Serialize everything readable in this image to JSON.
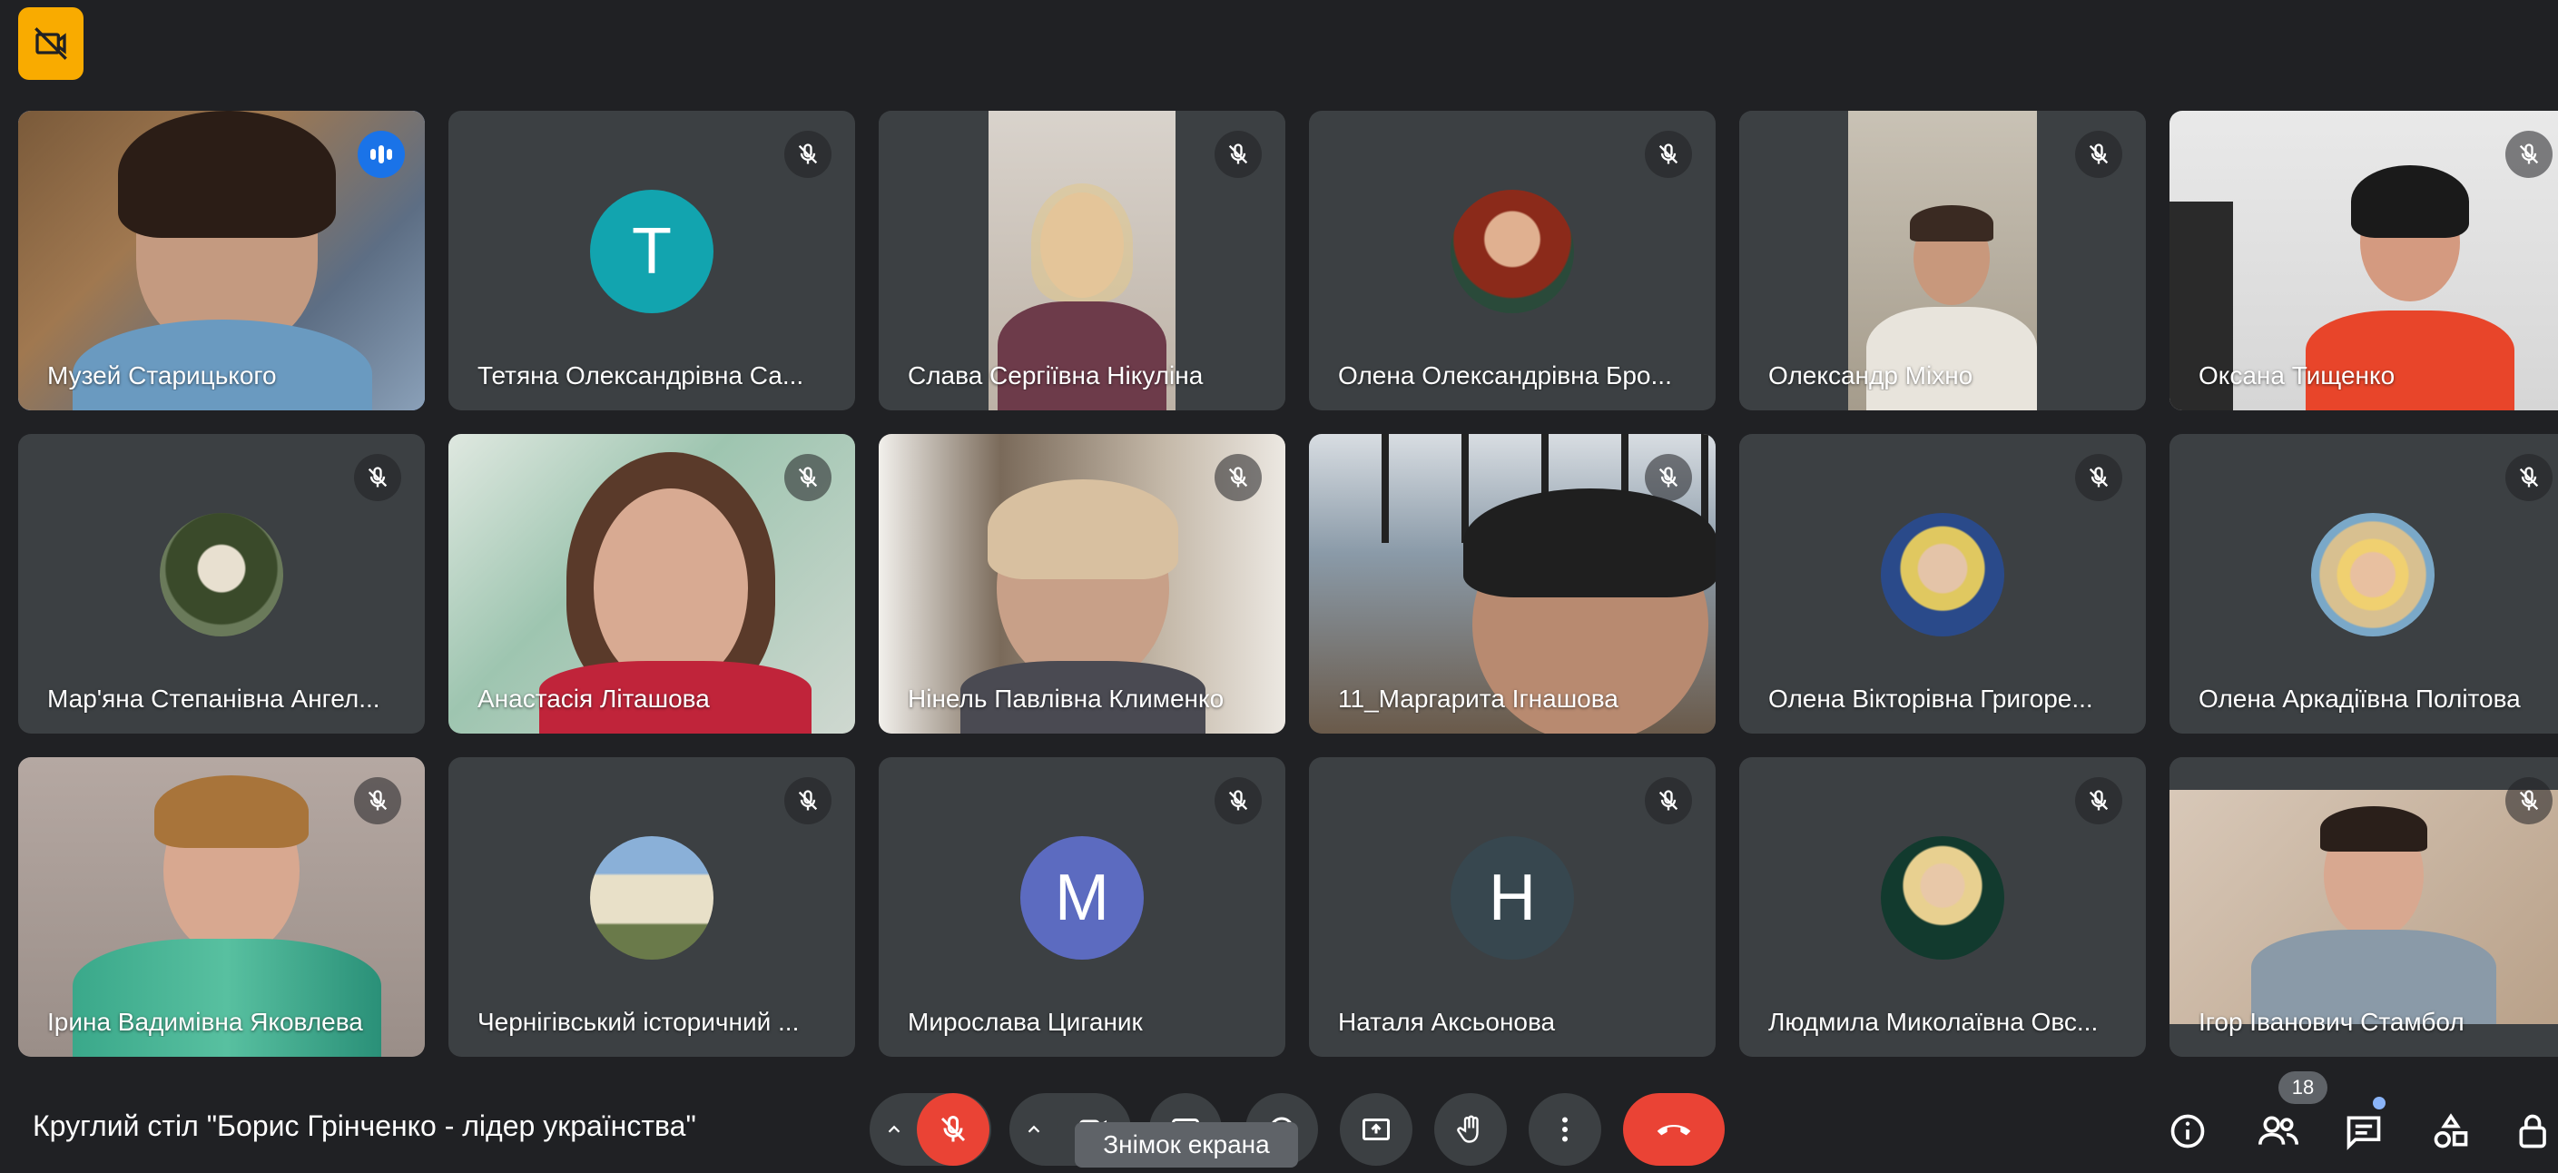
{
  "meeting": {
    "title": "Круглий стіл \"Борис Грінченко - лідер українства\"",
    "participant_count": "18",
    "tooltip": "Знімок екрана"
  },
  "colors": {
    "background": "#202124",
    "tile": "#3c4043",
    "speaking_outline": "#8ab4f8",
    "end_call": "#ea4335",
    "mic_off": "#ea4335",
    "top_badge": "#f9ab00"
  },
  "participants": [
    {
      "name": "Музей Старицького",
      "status": "speaking"
    },
    {
      "name": "Тетяна Олександрівна Са...",
      "avatar_letter": "T",
      "avatar_color": "#12a4af",
      "status": "muted"
    },
    {
      "name": "Слава Сергіївна Нікуліна",
      "status": "muted"
    },
    {
      "name": "Олена Олександрівна Бро...",
      "status": "muted"
    },
    {
      "name": "Олександр Міхно",
      "status": "muted"
    },
    {
      "name": "Оксана Тищенко",
      "status": "muted"
    },
    {
      "name": "Мар'яна Степанівна Ангел...",
      "status": "muted"
    },
    {
      "name": "Анастасія Літашова",
      "status": "muted"
    },
    {
      "name": "Нінель Павлівна Клименко",
      "status": "muted"
    },
    {
      "name": "11_Маргарита Ігнашова",
      "status": "muted"
    },
    {
      "name": "Олена Вікторівна Григоре...",
      "status": "muted"
    },
    {
      "name": "Олена Аркадіївна Політова",
      "status": "muted"
    },
    {
      "name": "Ірина Вадимівна Яковлева",
      "status": "muted"
    },
    {
      "name": "Чернігівський історичний ...",
      "status": "muted"
    },
    {
      "name": "Мирослава Циганик",
      "avatar_letter": "M",
      "avatar_color": "#5c6bc0",
      "status": "muted"
    },
    {
      "name": "Наталя Аксьонова",
      "avatar_letter": "H",
      "avatar_color": "#37474f",
      "status": "muted"
    },
    {
      "name": "Людмила Миколаївна Овс...",
      "status": "muted"
    },
    {
      "name": "Ігор Іванович Стамбол",
      "status": "muted"
    }
  ],
  "controls": [
    "more-audio-options",
    "microphone-off",
    "more-video-options",
    "camera",
    "captions",
    "effects",
    "present-screen",
    "raise-hand",
    "more-options",
    "leave-call"
  ],
  "right_controls": [
    "meeting-info",
    "people",
    "chat",
    "activities",
    "host-controls"
  ]
}
